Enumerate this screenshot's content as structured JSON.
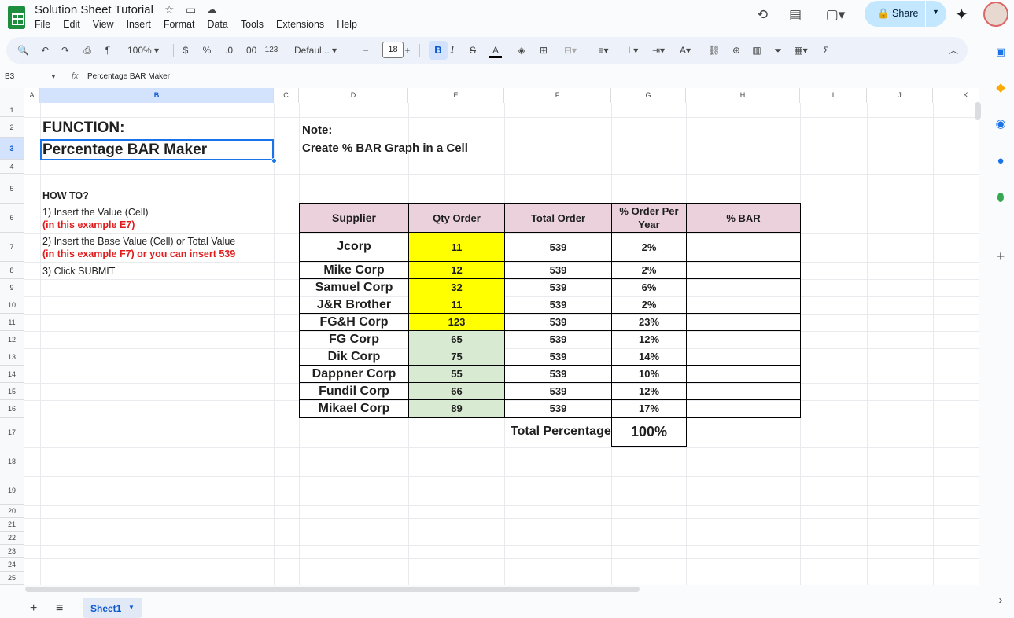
{
  "title_bar": {
    "doc_title": "Solution Sheet Tutorial",
    "star_icon": "star-icon",
    "move_icon": "folder-move-icon",
    "cloud_icon": "cloud-status-icon"
  },
  "menu": [
    "File",
    "Edit",
    "View",
    "Insert",
    "Format",
    "Data",
    "Tools",
    "Extensions",
    "Help"
  ],
  "header_actions": {
    "share_label": "Share"
  },
  "toolbar": {
    "zoom": "100%",
    "currency": "$",
    "percent": "%",
    "dec_decrease": ".0",
    "dec_increase": ".00",
    "number_format": "123",
    "font": "Defaul...",
    "font_size": "18",
    "minus": "−",
    "plus": "+",
    "bold": "B",
    "italic": "I",
    "strike": "S",
    "text_color": "A"
  },
  "formula_bar": {
    "cell_ref": "B3",
    "fx": "fx",
    "formula": "Percentage BAR Maker"
  },
  "columns": [
    "A",
    "B",
    "C",
    "D",
    "E",
    "F",
    "G",
    "H",
    "I",
    "J",
    "K"
  ],
  "rows": [
    "1",
    "2",
    "3",
    "4",
    "5",
    "6",
    "7",
    "8",
    "9",
    "10",
    "11",
    "12",
    "13",
    "14",
    "15",
    "16",
    "17",
    "18",
    "19",
    "20",
    "21",
    "22",
    "23",
    "24",
    "25"
  ],
  "sheet": {
    "function_label": "FUNCTION:",
    "function_name": "Percentage BAR Maker",
    "note_label": "Note:",
    "note_text": "Create % BAR Graph in a Cell",
    "howto_title": "HOW TO?",
    "step1": "1) Insert the Value (Cell)",
    "step1_example": "(in this example E7)",
    "step2": "2) Insert the Base Value (Cell) or Total Value",
    "step2_example": "(in this example F7) or you can insert 539",
    "step3": "3) Click SUBMIT",
    "table_headers": {
      "supplier": "Supplier",
      "qty": "Qty Order",
      "total": "Total Order",
      "pct": "% Order Per Year",
      "bar": "% BAR"
    },
    "table_rows": [
      {
        "supplier": "Jcorp",
        "qty": "11",
        "total": "539",
        "pct": "2%",
        "highlight": "#ffff00"
      },
      {
        "supplier": "Mike Corp",
        "qty": "12",
        "total": "539",
        "pct": "2%",
        "highlight": "#ffff00"
      },
      {
        "supplier": "Samuel Corp",
        "qty": "32",
        "total": "539",
        "pct": "6%",
        "highlight": "#ffff00"
      },
      {
        "supplier": "J&R Brother",
        "qty": "11",
        "total": "539",
        "pct": "2%",
        "highlight": "#ffff00"
      },
      {
        "supplier": "FG&H Corp",
        "qty": "123",
        "total": "539",
        "pct": "23%",
        "highlight": "#ffff00"
      },
      {
        "supplier": "FG Corp",
        "qty": "65",
        "total": "539",
        "pct": "12%",
        "highlight": "#d9ead3"
      },
      {
        "supplier": "Dik Corp",
        "qty": "75",
        "total": "539",
        "pct": "14%",
        "highlight": "#d9ead3"
      },
      {
        "supplier": "Dappner Corp",
        "qty": "55",
        "total": "539",
        "pct": "10%",
        "highlight": "#d9ead3"
      },
      {
        "supplier": "Fundil Corp",
        "qty": "66",
        "total": "539",
        "pct": "12%",
        "highlight": "#d9ead3"
      },
      {
        "supplier": "Mikael Corp",
        "qty": "89",
        "total": "539",
        "pct": "17%",
        "highlight": "#d9ead3"
      }
    ],
    "total_label": "Total Percentage",
    "total_value": "100%"
  },
  "sheet_tabs": {
    "active": "Sheet1"
  },
  "colors": {
    "header_pink": "#ead1dc",
    "accent_blue": "#0b57d0",
    "red_text": "#e01b1b"
  }
}
